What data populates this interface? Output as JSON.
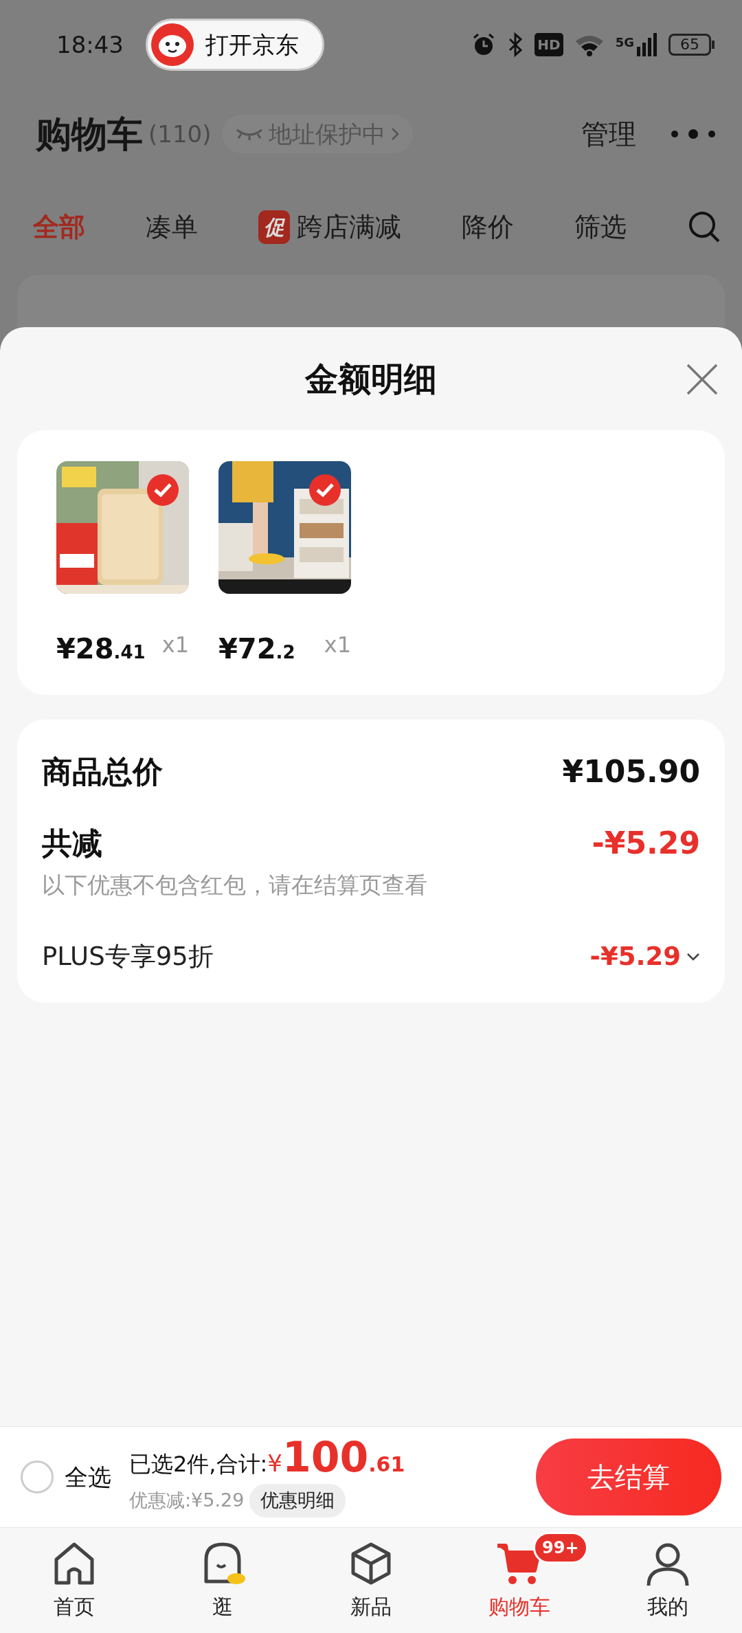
{
  "status_bar": {
    "time": "18:43",
    "app_pill": "打开京东",
    "hd": "HD",
    "network": "5G",
    "battery": "65"
  },
  "header": {
    "title": "购物车",
    "count": "(110)",
    "address_pill": "地址保护中",
    "manage": "管理"
  },
  "tabs": [
    {
      "label": "全部",
      "selected": true
    },
    {
      "label": "凑单",
      "selected": false
    },
    {
      "label": "跨店满减",
      "badge": "促",
      "selected": false
    },
    {
      "label": "降价",
      "selected": false
    },
    {
      "label": "筛选",
      "selected": false
    }
  ],
  "sheet": {
    "title": "金额明细",
    "items": [
      {
        "kind": "picture",
        "price": "¥28",
        "price_decimal": ".41",
        "quantity": "x1",
        "selected": true
      },
      {
        "kind": "picture",
        "price": "¥72",
        "price_decimal": ".2",
        "quantity": "x1",
        "selected": true
      }
    ],
    "total": {
      "label": "商品总价",
      "value": "¥105.90"
    },
    "reduction": {
      "label": "共减",
      "value": "-¥5.29",
      "note": "以下优惠不包含红包，请在结算页查看"
    },
    "discounts": [
      {
        "label": "PLUS专享95折",
        "value": "-¥5.29",
        "expanded": false
      }
    ]
  },
  "checkout_bar": {
    "select_all": {
      "label": "全选",
      "checked": false
    },
    "summary": "已选2件,合计:",
    "currency": "¥",
    "total": "100",
    "total_decimal": ".61",
    "saved": "优惠减:¥5.29",
    "details_button": "优惠明细",
    "checkout_button": "去结算"
  },
  "nav": [
    {
      "kind": "home",
      "label": "首页",
      "selected": false
    },
    {
      "kind": "browse",
      "label": "逛",
      "selected": false
    },
    {
      "kind": "new",
      "label": "新品",
      "selected": false
    },
    {
      "kind": "cart",
      "label": "购物车",
      "badge": "99+",
      "selected": true
    },
    {
      "kind": "me",
      "label": "我的",
      "selected": false
    }
  ]
}
